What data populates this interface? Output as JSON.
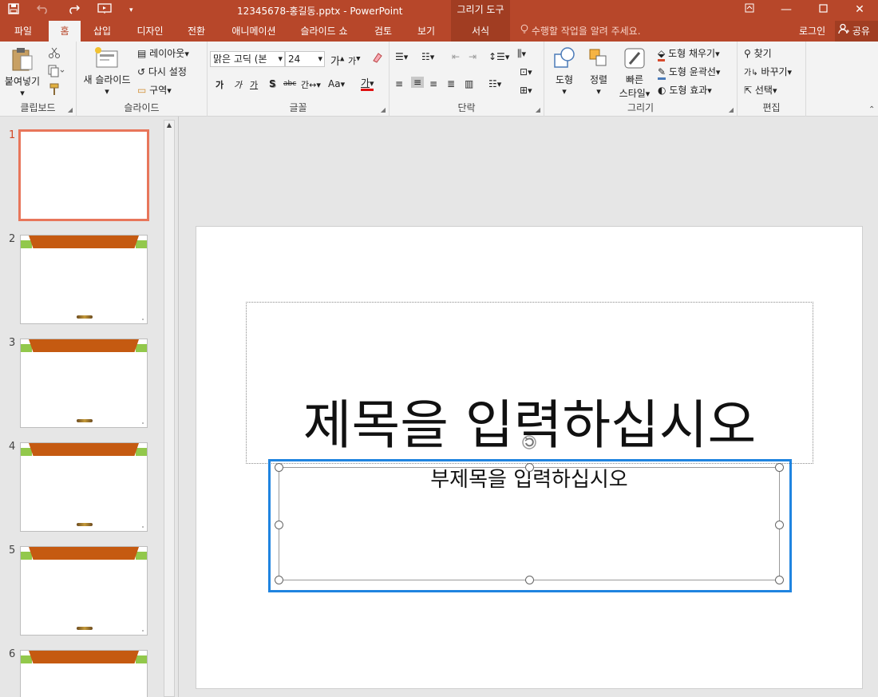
{
  "window": {
    "title": "12345678-홍길동.pptx - PowerPoint",
    "context_tools_title": "그리기 도구"
  },
  "qat": {
    "save_icon": "save-icon",
    "undo_icon": "undo-icon",
    "redo_icon": "redo-icon",
    "present_icon": "present-from-start-icon",
    "customize_icon": "customize-qat-icon"
  },
  "tabs": [
    {
      "label": "파일"
    },
    {
      "label": "홈"
    },
    {
      "label": "삽입"
    },
    {
      "label": "디자인"
    },
    {
      "label": "전환"
    },
    {
      "label": "애니메이션"
    },
    {
      "label": "슬라이드 쇼"
    },
    {
      "label": "검토"
    },
    {
      "label": "보기"
    },
    {
      "label": "서식"
    }
  ],
  "tell_me": "수행할 작업을 알려 주세요.",
  "login": "로그인",
  "share": "공유",
  "ribbon": {
    "clipboard": {
      "paste": "붙여넣기",
      "label": "클립보드"
    },
    "slides": {
      "new_slide": "새 슬라이드",
      "layout": "레이아웃",
      "reset": "다시 설정",
      "section": "구역",
      "label": "슬라이드"
    },
    "font": {
      "font_name": "맑은 고딕 (본",
      "font_size": "24",
      "label": "글꼴",
      "change_case": "Aa",
      "font_color": "가",
      "bold": "가",
      "italic": "가",
      "underline": "가",
      "shadow": "S",
      "strike": "abc",
      "spacing": "간"
    },
    "paragraph": {
      "label": "단락"
    },
    "drawing": {
      "shapes": "도형",
      "arrange": "정렬",
      "quick_styles_1": "빠른",
      "quick_styles_2": "스타일",
      "fill": "도형 채우기",
      "outline": "도형 윤곽선",
      "effects": "도형 효과",
      "label": "그리기"
    },
    "editing": {
      "find": "찾기",
      "replace": "바꾸기",
      "select": "선택",
      "label": "편집"
    }
  },
  "thumbnails": [
    {
      "num": "1"
    },
    {
      "num": "2"
    },
    {
      "num": "3"
    },
    {
      "num": "4"
    },
    {
      "num": "5"
    },
    {
      "num": "6"
    }
  ],
  "slide": {
    "title": "제목을 입력하십시오",
    "subtitle": "부제목을 입력하십시오"
  },
  "colors": {
    "accent": "#b7472a",
    "selection": "#1f84e0",
    "thumb_band": "#c55a11",
    "thumb_green": "#92c84b"
  }
}
